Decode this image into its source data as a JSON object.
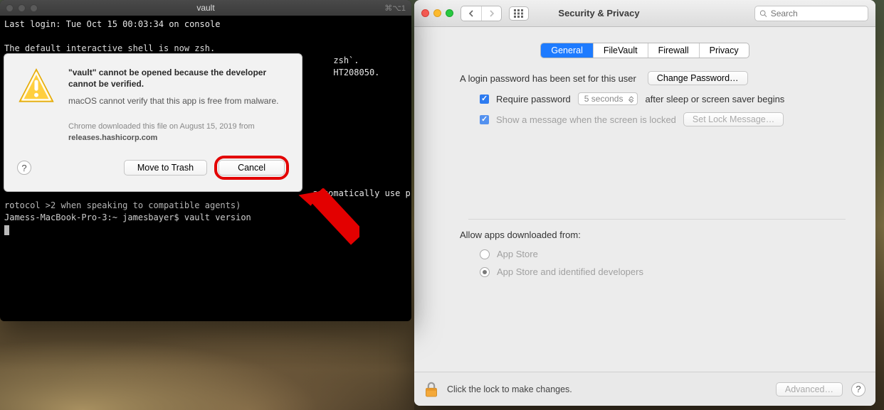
{
  "terminal": {
    "title": "vault",
    "kbd_hint": "⌘⌥1",
    "lines": {
      "l0": "Last login: Tue Oct 15 00:03:34 on console",
      "l1": "",
      "l2": "The default interactive shell is now zsh.",
      "l3_right": "zsh`.",
      "l4_right": "HT208050.",
      "l5_right": "automatically use p",
      "l6": "rotocol >2 when speaking to compatible agents)",
      "l7": "Jamess-MacBook-Pro-3:~ jamesbayer$ vault version"
    }
  },
  "alert": {
    "title": "\"vault\" cannot be opened because the developer cannot be verified.",
    "subtitle": "macOS cannot verify that this app is free from malware.",
    "meta_prefix": "Chrome downloaded this file on August 15, 2019 from",
    "meta_site": "releases.hashicorp.com",
    "help_label": "?",
    "move_to_trash": "Move to Trash",
    "cancel": "Cancel"
  },
  "prefs": {
    "title": "Security & Privacy",
    "search_placeholder": "Search",
    "tabs": {
      "general": "General",
      "filevault": "FileVault",
      "firewall": "Firewall",
      "privacy": "Privacy"
    },
    "login_set": "A login password has been set for this user",
    "change_pw": "Change Password…",
    "require_pw": "Require password",
    "require_delay": "5 seconds",
    "require_suffix": "after sleep or screen saver begins",
    "show_lock_msg": "Show a message when the screen is locked",
    "set_lock_msg": "Set Lock Message…",
    "allow_title": "Allow apps downloaded from:",
    "allow_appstore": "App Store",
    "allow_identified": "App Store and identified developers",
    "footer_text": "Click the lock to make changes.",
    "advanced": "Advanced…",
    "footer_help": "?"
  }
}
